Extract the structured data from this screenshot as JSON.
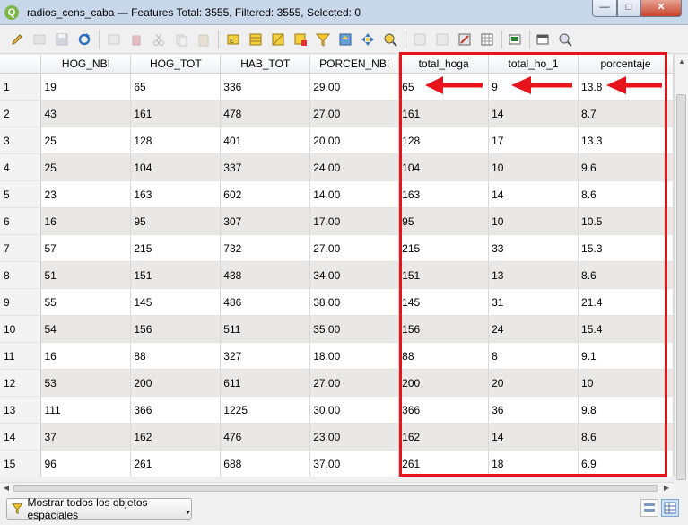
{
  "window": {
    "title": "radios_cens_caba — Features Total: 3555, Filtered: 3555, Selected: 0",
    "app_icon": "Q",
    "controls": {
      "minimize": "—",
      "maximize": "□",
      "close": "✕"
    }
  },
  "toolbar": {
    "icons": [
      "pencil-icon",
      "multi-edit-icon",
      "save-icon",
      "reload-icon",
      "add-feature-icon",
      "delete-icon",
      "cut-icon",
      "copy-icon",
      "paste-icon",
      "expression-select-icon",
      "select-all-icon",
      "invert-selection-icon",
      "deselect-icon",
      "filter-icon",
      "move-to-top-icon",
      "pan-to-selected-icon",
      "zoom-to-selected-icon",
      "new-field-icon",
      "delete-field-icon",
      "field-calculator-icon",
      "conditional-formatting-icon",
      "actions-icon",
      "dock-icon",
      "organize-columns-icon"
    ]
  },
  "table": {
    "columns": [
      "HOG_NBI",
      "HOG_TOT",
      "HAB_TOT",
      "PORCEN_NBI",
      "total_hoga",
      "total_ho_1",
      "porcentaje"
    ],
    "rows": [
      {
        "n": "1",
        "c": [
          "19",
          "65",
          "336",
          "29.00",
          "65",
          "9",
          "13.8"
        ]
      },
      {
        "n": "2",
        "c": [
          "43",
          "161",
          "478",
          "27.00",
          "161",
          "14",
          "8.7"
        ]
      },
      {
        "n": "3",
        "c": [
          "25",
          "128",
          "401",
          "20.00",
          "128",
          "17",
          "13.3"
        ]
      },
      {
        "n": "4",
        "c": [
          "25",
          "104",
          "337",
          "24.00",
          "104",
          "10",
          "9.6"
        ]
      },
      {
        "n": "5",
        "c": [
          "23",
          "163",
          "602",
          "14.00",
          "163",
          "14",
          "8.6"
        ]
      },
      {
        "n": "6",
        "c": [
          "16",
          "95",
          "307",
          "17.00",
          "95",
          "10",
          "10.5"
        ]
      },
      {
        "n": "7",
        "c": [
          "57",
          "215",
          "732",
          "27.00",
          "215",
          "33",
          "15.3"
        ]
      },
      {
        "n": "8",
        "c": [
          "51",
          "151",
          "438",
          "34.00",
          "151",
          "13",
          "8.6"
        ]
      },
      {
        "n": "9",
        "c": [
          "55",
          "145",
          "486",
          "38.00",
          "145",
          "31",
          "21.4"
        ]
      },
      {
        "n": "10",
        "c": [
          "54",
          "156",
          "511",
          "35.00",
          "156",
          "24",
          "15.4"
        ]
      },
      {
        "n": "11",
        "c": [
          "16",
          "88",
          "327",
          "18.00",
          "88",
          "8",
          "9.1"
        ]
      },
      {
        "n": "12",
        "c": [
          "53",
          "200",
          "611",
          "27.00",
          "200",
          "20",
          "10"
        ]
      },
      {
        "n": "13",
        "c": [
          "111",
          "366",
          "1225",
          "30.00",
          "366",
          "36",
          "9.8"
        ]
      },
      {
        "n": "14",
        "c": [
          "37",
          "162",
          "476",
          "23.00",
          "162",
          "14",
          "8.6"
        ]
      },
      {
        "n": "15",
        "c": [
          "96",
          "261",
          "688",
          "37.00",
          "261",
          "18",
          "6.9"
        ]
      }
    ]
  },
  "annotation": {
    "color": "#e8141b"
  },
  "footer": {
    "filter_label": "Mostrar todos los objetos espaciales",
    "filter_icon": "funnel-icon",
    "view_icons": [
      "form-view-icon",
      "table-view-icon"
    ]
  }
}
